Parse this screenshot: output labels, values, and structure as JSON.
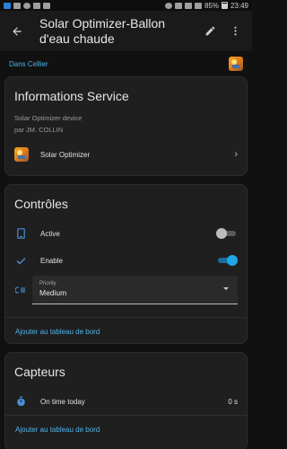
{
  "status_bar": {
    "battery_pct": "85%",
    "time": "23:49"
  },
  "toolbar": {
    "title": "Solar Optimizer-Ballon d'eau chaude",
    "back_icon": "arrow-left-icon",
    "edit_icon": "pencil-icon",
    "more_icon": "more-vert-icon"
  },
  "area": {
    "link": "Dans Cellier"
  },
  "service_card": {
    "title": "Informations Service",
    "description_line1": "Solar Optimizer device",
    "description_line2": "par JM. COLLIN",
    "integration_name": "Solar Optimizer"
  },
  "controls_card": {
    "title": "Contrôles",
    "items": [
      {
        "label": "Active",
        "icon": "phone-icon",
        "state": false
      },
      {
        "label": "Enable",
        "icon": "check-icon",
        "state": true
      }
    ],
    "select": {
      "label": "Priority",
      "value": "Medium",
      "icon": "priority-icon"
    },
    "action": "Ajouter au tableau de bord"
  },
  "sensors_card": {
    "title": "Capteurs",
    "items": [
      {
        "label": "On time today",
        "value": "0 s",
        "icon": "timer-icon"
      }
    ],
    "action": "Ajouter au tableau de bord"
  },
  "colors": {
    "accent": "#4fb3e8",
    "switch_on": "#1ea7e6",
    "icon": "#4a8fd6",
    "background": "#111111",
    "card": "#1f1f1f"
  }
}
